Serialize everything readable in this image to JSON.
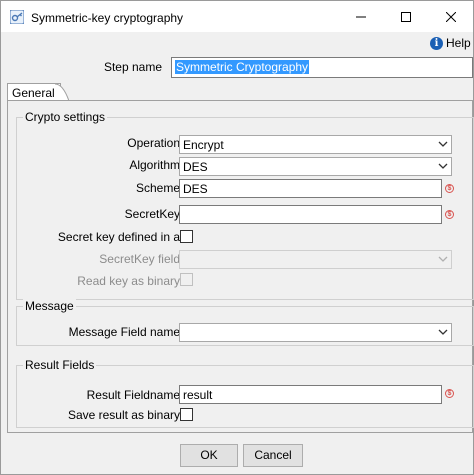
{
  "window": {
    "title": "Symmetric-key cryptography",
    "help_label": "Help"
  },
  "step": {
    "label": "Step name",
    "value": "Symmetric Cryptography"
  },
  "tabs": [
    {
      "label": "General",
      "active": true
    }
  ],
  "crypto": {
    "title": "Crypto settings",
    "operation": {
      "label": "Operation",
      "value": "Encrypt"
    },
    "algorithm": {
      "label": "Algorithm",
      "value": "DES"
    },
    "scheme": {
      "label": "Scheme",
      "value": "DES"
    },
    "secretkey": {
      "label": "SecretKey",
      "value": ""
    },
    "secret_in_field": {
      "label": "Secret key defined in a",
      "checked": false
    },
    "secretkey_field": {
      "label": "SecretKey field",
      "value": "",
      "enabled": false
    },
    "read_binary": {
      "label": "Read key as binary",
      "checked": false,
      "enabled": false
    }
  },
  "message": {
    "title": "Message",
    "field": {
      "label": "Message Field name",
      "value": ""
    }
  },
  "result": {
    "title": "Result Fields",
    "fieldname": {
      "label": "Result Fieldname",
      "value": "result"
    },
    "save_binary": {
      "label": "Save result as binary",
      "checked": false
    }
  },
  "buttons": {
    "ok": "OK",
    "cancel": "Cancel"
  },
  "colors": {
    "selection": "#3399ff",
    "help_icon": "#1a5fb4",
    "variable_icon": "#d9534f"
  }
}
